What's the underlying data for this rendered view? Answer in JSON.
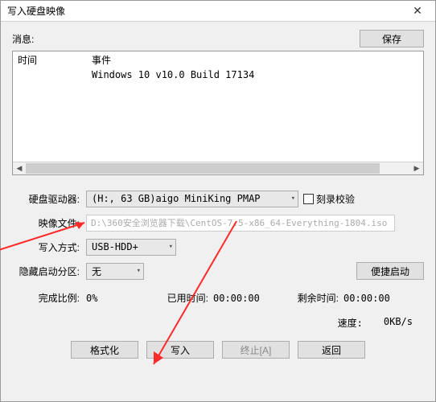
{
  "titlebar": {
    "title": "写入硬盘映像"
  },
  "info": {
    "label": "消息:",
    "save_label": "保存"
  },
  "log": {
    "col_time": "时间",
    "col_event": "事件",
    "rows": [
      {
        "time": "",
        "event": "Windows 10 v10.0 Build 17134"
      }
    ]
  },
  "form": {
    "drive_label": "硬盘驱动器:",
    "drive_value": "(H:, 63 GB)aigo    MiniKing        PMAP",
    "verify_label": "刻录校验",
    "image_label": "映像文件:",
    "image_value": "D:\\360安全浏览器下载\\CentOS-7.5-x86_64-Everything-1804.iso",
    "write_mode_label": "写入方式:",
    "write_mode_value": "USB-HDD+",
    "hide_partition_label": "隐藏启动分区:",
    "hide_partition_value": "无",
    "convenient_boot_label": "便捷启动"
  },
  "stats": {
    "percent_label": "完成比例:",
    "percent_value": "0%",
    "elapsed_label": "已用时间:",
    "elapsed_value": "00:00:00",
    "remaining_label": "剩余时间:",
    "remaining_value": "00:00:00",
    "speed_label": "速度:",
    "speed_value": "0KB/s"
  },
  "buttons": {
    "format": "格式化",
    "write": "写入",
    "abort": "终止[A]",
    "back": "返回"
  }
}
